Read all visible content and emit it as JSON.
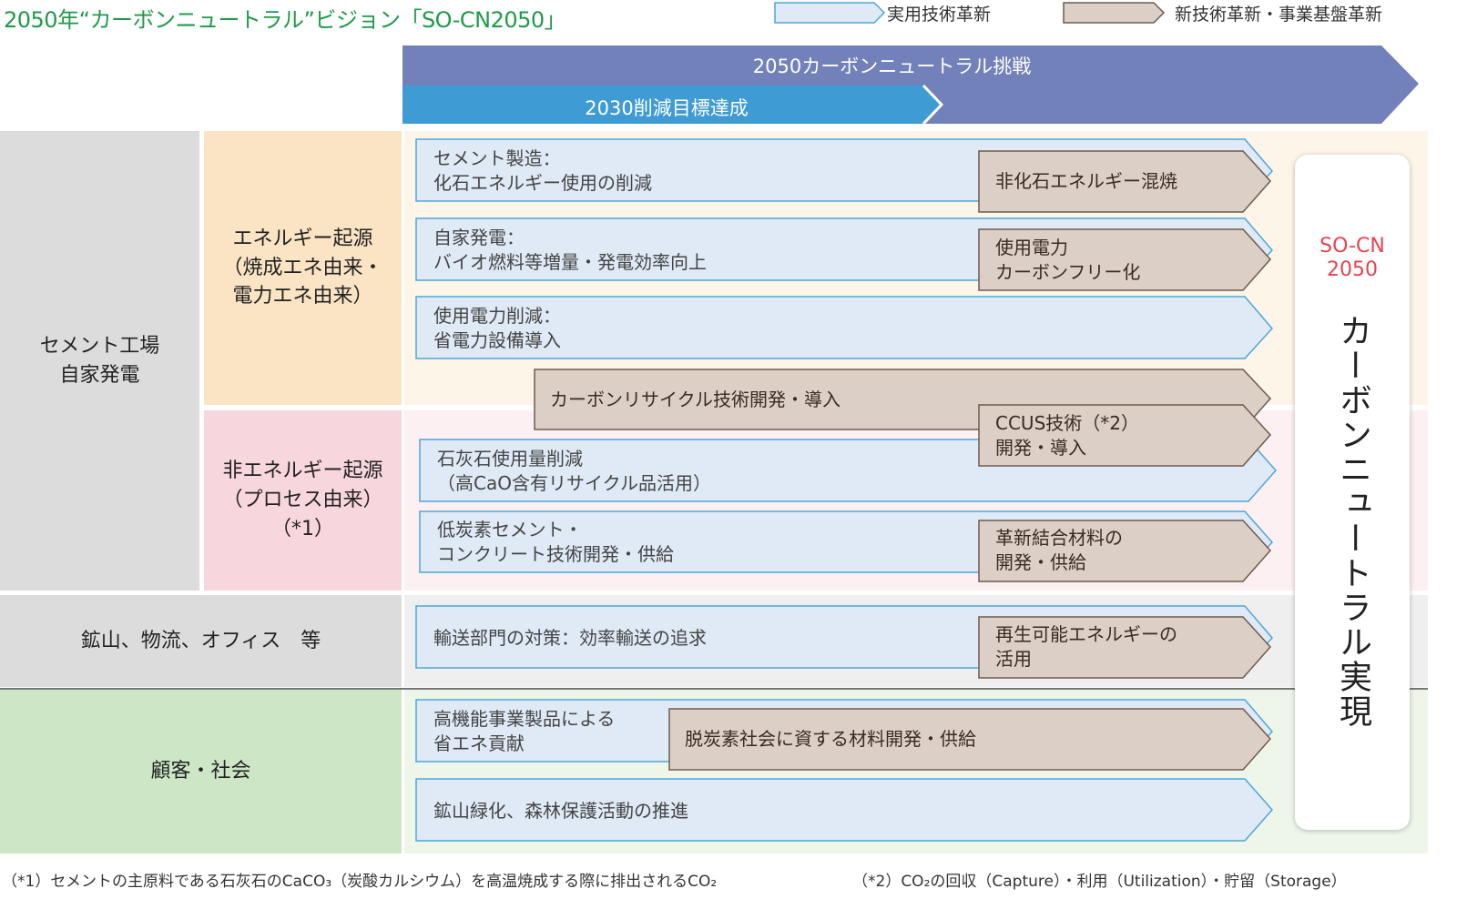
{
  "title": "2050年“カーボンニュートラル”ビジョン「SO-CN2050」",
  "legend": {
    "practical": "実用技術革新",
    "new_tech": "新技術革新・事業基盤革新"
  },
  "banners": {
    "cn2050": "2050カーボンニュートラル挑戦",
    "target2030": "2030削減目標達成"
  },
  "categories": {
    "plant": "セメント工場\n自家発電",
    "energy": "エネルギー起源\n（焼成エネ由来・\n電力エネ由来）",
    "non_energy": "非エネルギー起源\n（プロセス由来）\n（*1）",
    "mining": "鉱山、物流、オフィス　等",
    "customer": "顧客・社会"
  },
  "bars": {
    "cement": "セメント製造：\n化石エネルギー使用の削減",
    "selfgen": "自家発電：\nバイオ燃料等増量・発電効率向上",
    "power": "使用電力削減：\n省電力設備導入",
    "limestone": "石灰石使用量削減\n（高CaO含有リサイクル品活用）",
    "lowcarbon": "低炭素セメント・\nコンクリート技術開発・供給",
    "transport": "輸送部門の対策：効率輸送の追求",
    "products": "高機能事業製品による\n省エネ貢献",
    "greening": "鉱山緑化、森林保護活動の推進"
  },
  "brown": {
    "nonfossil": "非化石エネルギー混焼",
    "carbonfree": "使用電力\nカーボンフリー化",
    "recycle": "カーボンリサイクル技術開発・導入",
    "ccus": "CCUS技術（*2）\n開発・導入",
    "material": "革新結合材料の\n開発・供給",
    "renewable": "再生可能エネルギーの\n活用",
    "decarb": "脱炭素社会に資する材料開発・供給"
  },
  "goal": {
    "brand": "SO-CN\n2050",
    "text": "カーボンニュートラル実現"
  },
  "notes": {
    "n1": "（*1）セメントの主原料である石灰石のCaCO₃（炭酸カルシウム）を高温焼成する際に排出されるCO₂",
    "n2": "（*2）CO₂の回収（Capture）・利用（Utilization）・貯留（Storage）"
  },
  "colors": {
    "title": "#1f9a4a",
    "banner_purple": "#7381ba",
    "banner_blue": "#3f9bd3",
    "bar_fill": "#dfeaf6",
    "bar_stroke": "#4fa6d8",
    "brown_fill": "#dbcfc6",
    "brown_stroke": "#6e5a4e",
    "energy_bg": "#fae4c4",
    "nonenergy_bg": "#f8d6de",
    "gray_bg": "#dcdcdc",
    "green_bg": "#cde6c6",
    "brand_red": "#e8424f"
  }
}
